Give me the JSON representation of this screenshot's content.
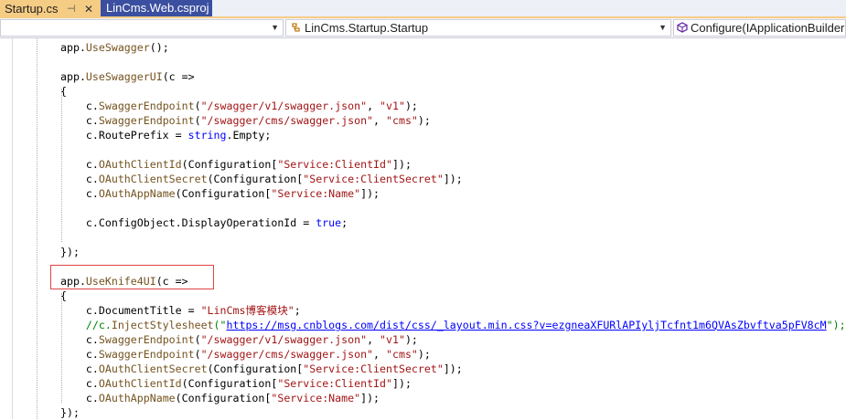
{
  "tabs": [
    {
      "label": "Startup.cs",
      "pin": "⊣",
      "close": "✕"
    },
    {
      "label": "LinCms.Web.csproj"
    }
  ],
  "nav": {
    "project": "",
    "type": "LinCms.Startup.Startup",
    "member": "Configure(IApplicationBuilder"
  },
  "code": [
    [
      [
        "p",
        "app."
      ],
      [
        "m",
        "UseSwagger"
      ],
      [
        "p",
        "();"
      ]
    ],
    [],
    [
      [
        "p",
        "app."
      ],
      [
        "m",
        "UseSwaggerUI"
      ],
      [
        "p",
        "(c =>"
      ]
    ],
    [
      [
        "p",
        "{"
      ]
    ],
    [
      [
        "p",
        "    c."
      ],
      [
        "m",
        "SwaggerEndpoint"
      ],
      [
        "p",
        "("
      ],
      [
        "s",
        "\"/swagger/v1/swagger.json\""
      ],
      [
        "p",
        ", "
      ],
      [
        "s",
        "\"v1\""
      ],
      [
        "p",
        ");"
      ]
    ],
    [
      [
        "p",
        "    c."
      ],
      [
        "m",
        "SwaggerEndpoint"
      ],
      [
        "p",
        "("
      ],
      [
        "s",
        "\"/swagger/cms/swagger.json\""
      ],
      [
        "p",
        ", "
      ],
      [
        "s",
        "\"cms\""
      ],
      [
        "p",
        ");"
      ]
    ],
    [
      [
        "p",
        "    c.RoutePrefix = "
      ],
      [
        "k",
        "string"
      ],
      [
        "p",
        ".Empty;"
      ]
    ],
    [],
    [
      [
        "p",
        "    c."
      ],
      [
        "m",
        "OAuthClientId"
      ],
      [
        "p",
        "(Configuration["
      ],
      [
        "s",
        "\"Service:ClientId\""
      ],
      [
        "p",
        "]);"
      ]
    ],
    [
      [
        "p",
        "    c."
      ],
      [
        "m",
        "OAuthClientSecret"
      ],
      [
        "p",
        "(Configuration["
      ],
      [
        "s",
        "\"Service:ClientSecret\""
      ],
      [
        "p",
        "]);"
      ]
    ],
    [
      [
        "p",
        "    c."
      ],
      [
        "m",
        "OAuthAppName"
      ],
      [
        "p",
        "(Configuration["
      ],
      [
        "s",
        "\"Service:Name\""
      ],
      [
        "p",
        "]);"
      ]
    ],
    [],
    [
      [
        "p",
        "    c.ConfigObject.DisplayOperationId = "
      ],
      [
        "k",
        "true"
      ],
      [
        "p",
        ";"
      ]
    ],
    [],
    [
      [
        "p",
        "});"
      ]
    ],
    [],
    [
      [
        "p",
        "app."
      ],
      [
        "m",
        "UseKnife4UI"
      ],
      [
        "p",
        "(c =>"
      ]
    ],
    [
      [
        "p",
        "{"
      ]
    ],
    [
      [
        "p",
        "    c.DocumentTitle = "
      ],
      [
        "s",
        "\"LinCms博客模块\""
      ],
      [
        "p",
        ";"
      ]
    ],
    [
      [
        "cm",
        "    //c."
      ],
      [
        "m",
        "InjectStylesheet"
      ],
      [
        "cm",
        "(\""
      ],
      [
        "lnk",
        "https://msg.cnblogs.com/dist/css/_layout.min.css?v=ezgneaXFURlAPIyljTcfnt1m6QVAsZbvftva5pFV8cM"
      ],
      [
        "cm",
        "\");"
      ]
    ],
    [
      [
        "p",
        "    c."
      ],
      [
        "m",
        "SwaggerEndpoint"
      ],
      [
        "p",
        "("
      ],
      [
        "s",
        "\"/swagger/v1/swagger.json\""
      ],
      [
        "p",
        ", "
      ],
      [
        "s",
        "\"v1\""
      ],
      [
        "p",
        ");"
      ]
    ],
    [
      [
        "p",
        "    c."
      ],
      [
        "m",
        "SwaggerEndpoint"
      ],
      [
        "p",
        "("
      ],
      [
        "s",
        "\"/swagger/cms/swagger.json\""
      ],
      [
        "p",
        ", "
      ],
      [
        "s",
        "\"cms\""
      ],
      [
        "p",
        ");"
      ]
    ],
    [
      [
        "p",
        "    c."
      ],
      [
        "m",
        "OAuthClientSecret"
      ],
      [
        "p",
        "(Configuration["
      ],
      [
        "s",
        "\"Service:ClientSecret\""
      ],
      [
        "p",
        "]);"
      ]
    ],
    [
      [
        "p",
        "    c."
      ],
      [
        "m",
        "OAuthClientId"
      ],
      [
        "p",
        "(Configuration["
      ],
      [
        "s",
        "\"Service:ClientId\""
      ],
      [
        "p",
        "]);"
      ]
    ],
    [
      [
        "p",
        "    c."
      ],
      [
        "m",
        "OAuthAppName"
      ],
      [
        "p",
        "(Configuration["
      ],
      [
        "s",
        "\"Service:Name\""
      ],
      [
        "p",
        "]);"
      ]
    ],
    [
      [
        "p",
        "});"
      ]
    ]
  ],
  "colors": {
    "method": "#74531f",
    "string": "#a31515",
    "keyword": "#0000ff",
    "comment": "#008000",
    "highlight_box": "#e04343",
    "active_tab": "#f5cc84"
  },
  "icons": {
    "pin": "pin-icon",
    "close": "close-icon",
    "class": "class-icon",
    "method": "method-icon",
    "dropdown": "chevron-down-icon"
  }
}
